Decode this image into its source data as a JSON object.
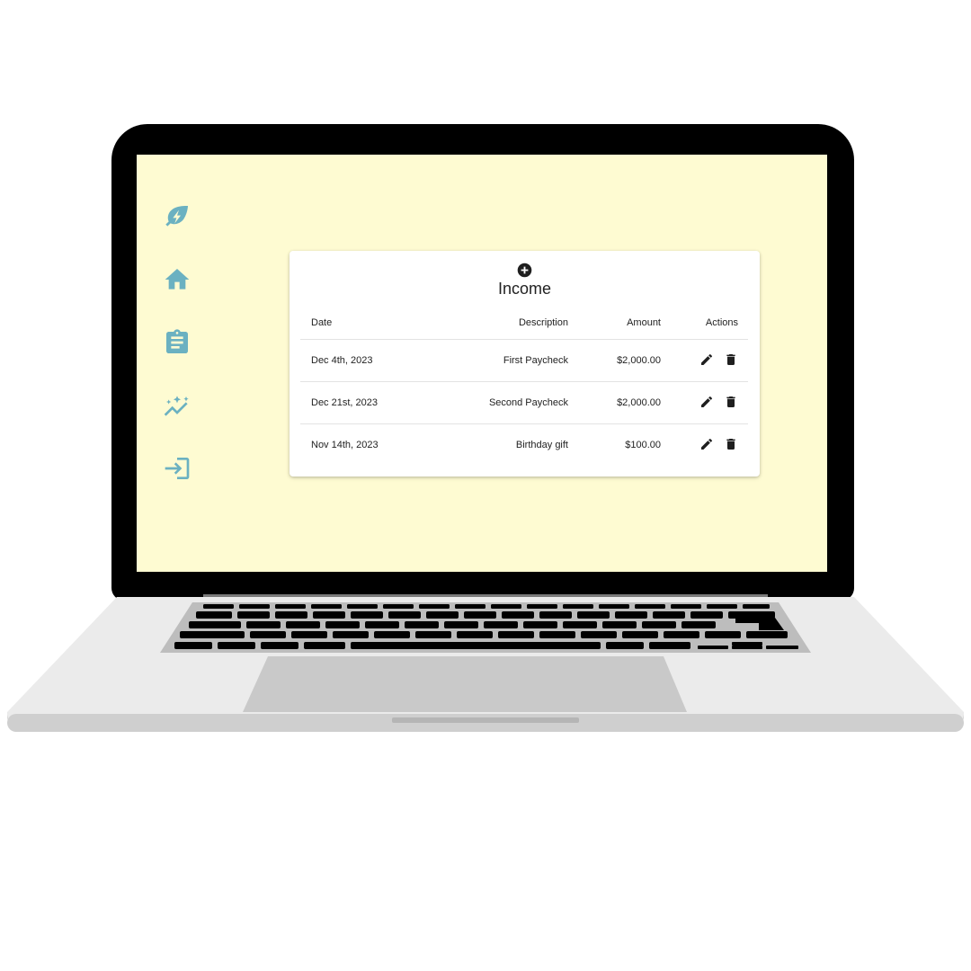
{
  "colors": {
    "screen_bg": "#fefbd2",
    "sidebar_icon": "#6bb1c1",
    "card_bg": "#ffffff",
    "text": "#222222"
  },
  "sidebar": {
    "items": [
      {
        "icon": "leaf-bolt-logo-icon"
      },
      {
        "icon": "home-icon"
      },
      {
        "icon": "clipboard-icon"
      },
      {
        "icon": "sparkle-trend-icon"
      },
      {
        "icon": "login-icon"
      }
    ]
  },
  "income": {
    "add_icon": "add-circle-icon",
    "title": "Income",
    "columns": [
      "Date",
      "Description",
      "Amount",
      "Actions"
    ],
    "rows": [
      {
        "date": "Dec 4th, 2023",
        "description": "First Paycheck",
        "amount": "$2,000.00"
      },
      {
        "date": "Dec 21st, 2023",
        "description": "Second Paycheck",
        "amount": "$2,000.00"
      },
      {
        "date": "Nov 14th, 2023",
        "description": "Birthday gift",
        "amount": "$100.00"
      }
    ],
    "row_actions": [
      "edit-icon",
      "delete-icon"
    ]
  }
}
